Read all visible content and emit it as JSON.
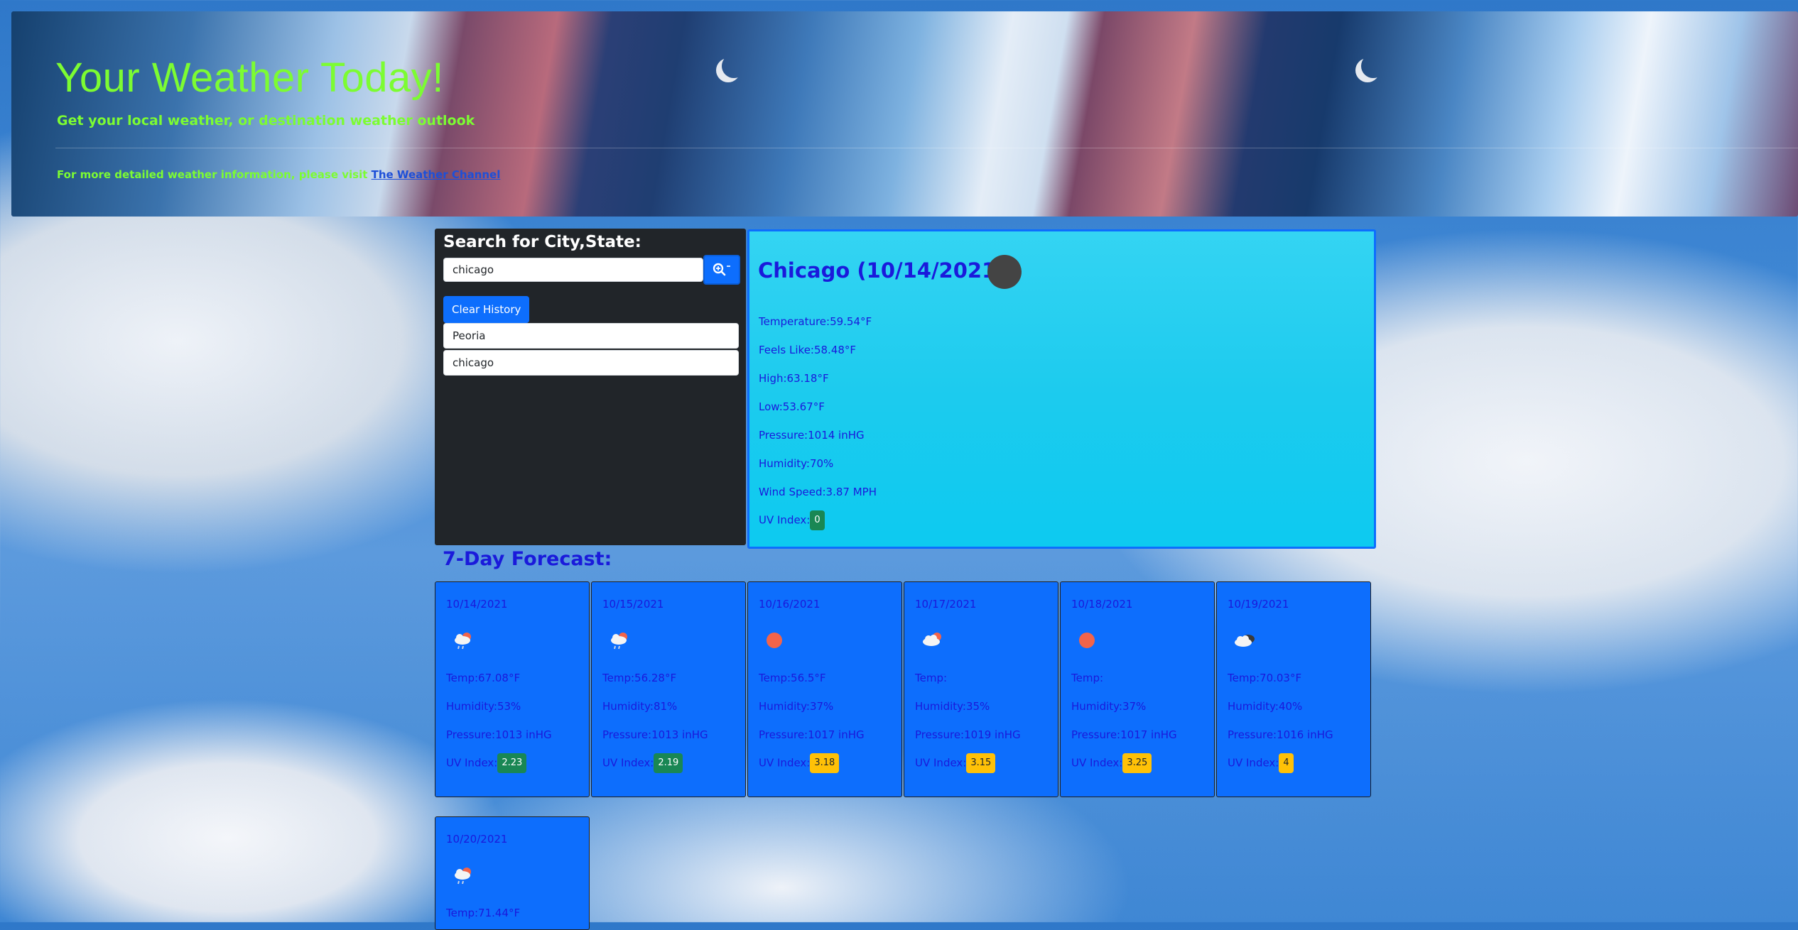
{
  "header": {
    "title": "Your Weather Today!",
    "subtitle": "Get your local weather, or destination weather outlook",
    "more_info_prefix": "For more detailed weather information, please visit",
    "more_info_link": "The Weather Channel"
  },
  "search": {
    "heading": "Search for City,State:",
    "input_value": "chicago",
    "search_button_icon": "search-zoom-icon",
    "clear_label": "Clear History",
    "history": [
      "Peoria",
      "chicago"
    ]
  },
  "current": {
    "heading": "Chicago (10/14/2021)",
    "icon": "weather-icon",
    "temperature": "Temperature:59.54°F",
    "feels_like": "Feels Like:58.48°F",
    "high": "High:63.18°F",
    "low": "Low:53.67°F",
    "pressure": "Pressure:1014 inHG",
    "humidity": "Humidity:70%",
    "wind": "Wind Speed:3.87 MPH",
    "uv_label": "UV Index:",
    "uv_value": "0",
    "uv_color": "#198754"
  },
  "forecast": {
    "heading": "7-Day Forecast:",
    "uv_label": "UV Index:",
    "days": [
      {
        "date": "10/14/2021",
        "icon": "cloud-rain-sun-icon",
        "temp": "Temp:67.08°F",
        "humidity": "Humidity:53%",
        "pressure": "Pressure:1013 inHG",
        "uv": "2.23",
        "uv_color": "#198754"
      },
      {
        "date": "10/15/2021",
        "icon": "cloud-rain-sun-icon",
        "temp": "Temp:56.28°F",
        "humidity": "Humidity:81%",
        "pressure": "Pressure:1013 inHG",
        "uv": "2.19",
        "uv_color": "#198754"
      },
      {
        "date": "10/16/2021",
        "icon": "sun-icon",
        "temp": "Temp:56.5°F",
        "humidity": "Humidity:37%",
        "pressure": "Pressure:1017 inHG",
        "uv": "3.18",
        "uv_color": "#ffc107"
      },
      {
        "date": "10/17/2021",
        "icon": "cloud-sun-icon",
        "temp": "Temp:",
        "humidity": "Humidity:35%",
        "pressure": "Pressure:1019 inHG",
        "uv": "3.15",
        "uv_color": "#ffc107"
      },
      {
        "date": "10/18/2021",
        "icon": "sun-icon",
        "temp": "Temp:",
        "humidity": "Humidity:37%",
        "pressure": "Pressure:1017 inHG",
        "uv": "3.25",
        "uv_color": "#ffc107"
      },
      {
        "date": "10/19/2021",
        "icon": "cloud-dark-icon",
        "temp": "Temp:70.03°F",
        "humidity": "Humidity:40%",
        "pressure": "Pressure:1016 inHG",
        "uv": "4",
        "uv_color": "#ffc107"
      },
      {
        "date": "10/20/2021",
        "icon": "cloud-rain-sun-icon",
        "temp": "Temp:71.44°F"
      }
    ]
  }
}
